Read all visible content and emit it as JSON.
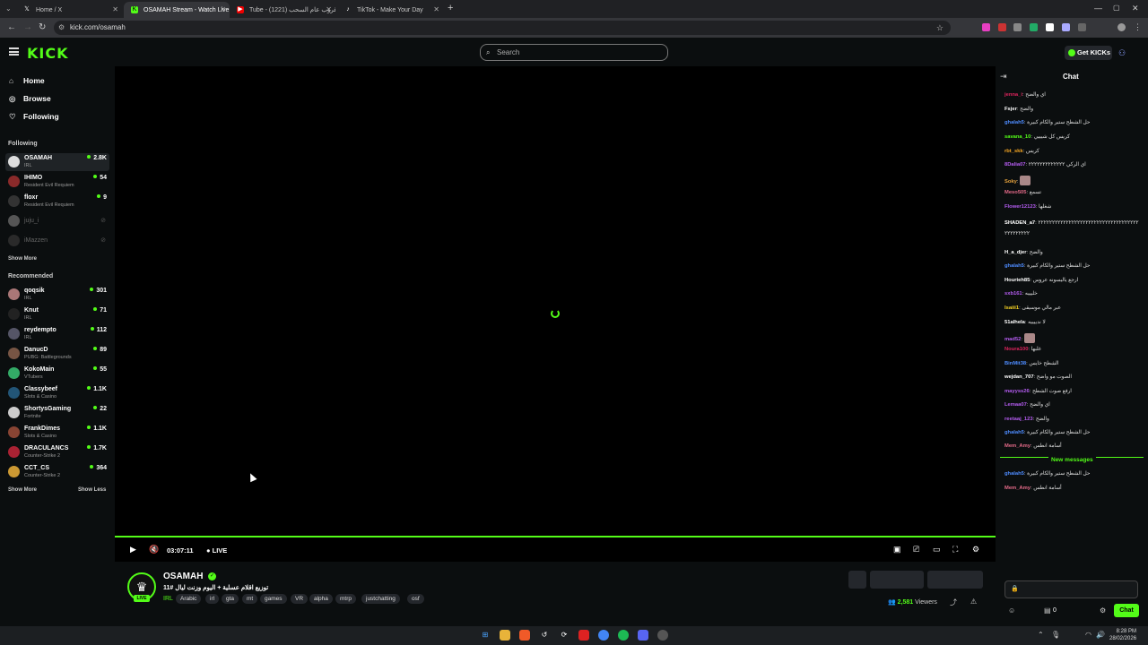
{
  "browser": {
    "tabs": [
      {
        "title": "Home / X",
        "icon": "x-logo-icon"
      },
      {
        "title": "OSAMAH Stream - Watch Live",
        "icon": "kick-logo-icon"
      },
      {
        "title": "Tube - قروب عام السحب (1221)",
        "icon": "youtube-icon"
      },
      {
        "title": "TikTok - Make Your Day",
        "icon": "tiktok-icon"
      }
    ],
    "url": "kick.com/osamah"
  },
  "header": {
    "logo": "KICK",
    "search_placeholder": "Search",
    "get_kicks_label": "Get KICKs"
  },
  "sidebar": {
    "nav": [
      {
        "label": "Home",
        "icon": "home-icon"
      },
      {
        "label": "Browse",
        "icon": "compass-icon"
      },
      {
        "label": "Following",
        "icon": "heart-icon"
      }
    ],
    "following_title": "Following",
    "following": [
      {
        "name": "OSAMAH",
        "category": "IRL",
        "viewers": "2.8K"
      },
      {
        "name": "IHIMO",
        "category": "Resident Evil Requiem",
        "viewers": "54"
      },
      {
        "name": "floxr",
        "category": "Resident Evil Requiem",
        "viewers": "9"
      },
      {
        "name": "juju_i",
        "category": "",
        "viewers": ""
      },
      {
        "name": "iMazzen",
        "category": "",
        "viewers": ""
      }
    ],
    "show_more": "Show More",
    "recommended_title": "Recommended",
    "recommended": [
      {
        "name": "qoqsik",
        "category": "IRL",
        "viewers": "301"
      },
      {
        "name": "Knut",
        "category": "IRL",
        "viewers": "71"
      },
      {
        "name": "reydempto",
        "category": "IRL",
        "viewers": "112"
      },
      {
        "name": "DanucD",
        "category": "PUBG: Battlegrounds",
        "viewers": "89"
      },
      {
        "name": "KokoMain",
        "category": "VTubers",
        "viewers": "55"
      },
      {
        "name": "Classybeef",
        "category": "Slots & Casino",
        "viewers": "1.1K"
      },
      {
        "name": "ShortysGaming",
        "category": "Fortnite",
        "viewers": "22"
      },
      {
        "name": "FrankDimes",
        "category": "Slots & Casino",
        "viewers": "1.1K"
      },
      {
        "name": "DRACULANCS",
        "category": "Counter-Strike 2",
        "viewers": "1.7K"
      },
      {
        "name": "CCT_CS",
        "category": "Counter-Strike 2",
        "viewers": "364"
      }
    ],
    "show_more_2": "Show More",
    "show_less": "Show Less"
  },
  "player": {
    "time": "03:07:11",
    "live": "LIVE"
  },
  "stream": {
    "streamer": "OSAMAH",
    "title": "توزيع اقلام عسلية + اليوم وزنت ليال #11",
    "category": "IRL",
    "tags": [
      "Arabic",
      "irl",
      "gta",
      "mt",
      "games",
      "VR",
      "alpha",
      "mtrp",
      "justchatting",
      "osf"
    ],
    "live_badge": "LIVE",
    "viewers_count": "2,581",
    "viewers_label": "Viewers"
  },
  "chat": {
    "title": "Chat",
    "messages": [
      {
        "user": "jenna_i",
        "text": "اي والضح",
        "color": "#e0245e"
      },
      {
        "user": "Fsjer",
        "text": "والضح",
        "color": "#ffffff"
      },
      {
        "user": "ghalah5",
        "text": "حل الشطح ستير والكام كبيرة",
        "color": "#4e8cff"
      },
      {
        "user": "savana_10",
        "text": "كريس كل شيييي",
        "color": "#53fc18"
      },
      {
        "user": "rbt_skk",
        "text": "كريس",
        "color": "#f5a623"
      },
      {
        "user": "8Dalia07",
        "text": "اي الركي ٢٢٢٢٢٢٢٢٢٢٢٢٢",
        "color": "#b45cf0"
      },
      {
        "user": "Soky",
        "text": "",
        "color": "#e8a33d"
      },
      {
        "user": "Meso505",
        "text": "تسمع",
        "color": "#e66b8a"
      },
      {
        "user": "Flower12123",
        "text": "شغلها",
        "color": "#b45cf0"
      },
      {
        "user": "SHADEN_a7",
        "text": "٢٢٢٢٢٢٢٢٢٢٢٢٢٢٢٢٢٢٢٢٢٢٢٢٢٢٢٢٢٢٢٢٢٢٢٢٢٢٢٢٢٢٢٢٢",
        "color": "#ffffff"
      },
      {
        "user": "H_a_djer",
        "text": "والضح",
        "color": "#ffffff"
      },
      {
        "user": "ghalah5",
        "text": "حل الشطح ستير والكام كبيرة",
        "color": "#4e8cff"
      },
      {
        "user": "Hourieh85",
        "text": "ارجع ياليسونه عروس",
        "color": "#ffffff"
      },
      {
        "user": "sxb161",
        "text": "خليييه",
        "color": "#b45cf0"
      },
      {
        "user": "Isaiii1",
        "text": "عبر مالي موسيقى",
        "color": "#f5d223"
      },
      {
        "user": "51alhela",
        "text": "لا ندييييه",
        "color": "#ffffff"
      },
      {
        "user": "mad52",
        "text": "",
        "color": "#b45cf0"
      },
      {
        "user": "Noura100",
        "text": "غلبها",
        "color": "#e0245e"
      },
      {
        "user": "BinMit38",
        "text": "الشطح خايس",
        "color": "#4e8cff"
      },
      {
        "user": "wejdan_707",
        "text": "الصوت مو واضح",
        "color": "#ffffff"
      },
      {
        "user": "mayyss26",
        "text": "ارفع صوت الشطح",
        "color": "#b45cf0"
      },
      {
        "user": "Lemaa07",
        "text": "اي والضح",
        "color": "#b45cf0"
      },
      {
        "user": "reetaaj_123",
        "text": "والضح",
        "color": "#b45cf0"
      },
      {
        "user": "ghalah5",
        "text": "حل الشطح ستير والكام كبيرة",
        "color": "#4e8cff"
      },
      {
        "user": "Mem_Amy",
        "text": "أسامة انطس",
        "color": "#e66b8a"
      }
    ],
    "new_messages_label": "New messages",
    "new_messages": [
      {
        "user": "ghalah5",
        "text": "حل الشطح ستير والكام كبيرة",
        "color": "#4e8cff"
      },
      {
        "user": "Mem_Amy",
        "text": "أسامة انطس",
        "color": "#e66b8a"
      }
    ],
    "kicks_count": "0",
    "chat_button": "Chat"
  },
  "taskbar": {
    "time": "8:28 PM",
    "date": "28/02/2026"
  }
}
